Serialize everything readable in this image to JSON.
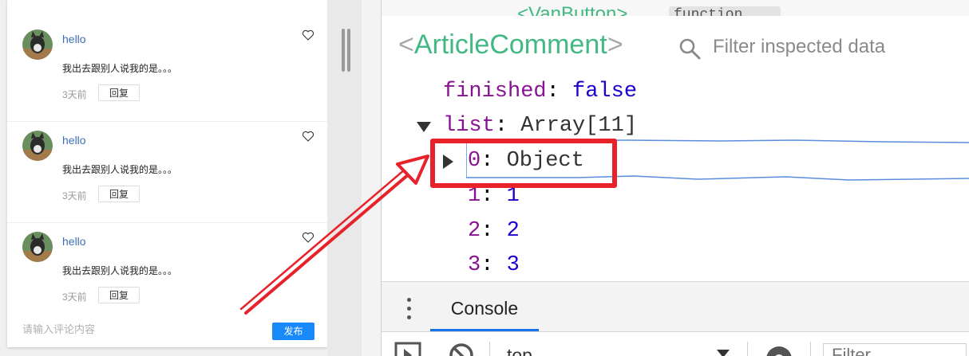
{
  "app": {
    "comments": [
      {
        "user": "hello",
        "text": "我出去跟别人说我的是。。。",
        "time": "3天前",
        "reply_label": "回复"
      },
      {
        "user": "hello",
        "text": "我出去跟别人说我的是。。。",
        "time": "3天前",
        "reply_label": "回复"
      },
      {
        "user": "hello",
        "text": "我出去跟别人说我的是。。。",
        "time": "3天前",
        "reply_label": "回复"
      }
    ],
    "input_placeholder": "请输入评论内容",
    "publish_label": "发布"
  },
  "devtools": {
    "top_peek": {
      "component": "<VanButton>",
      "tag": "function"
    },
    "component": {
      "open": "<",
      "name": "ArticleComment",
      "close": ">"
    },
    "filter_placeholder": "Filter inspected data",
    "state": {
      "finished": {
        "key": "finished",
        "sep": ": ",
        "value": "false"
      },
      "list": {
        "key": "list",
        "sep": ": ",
        "value": "Array[11]"
      },
      "items": [
        {
          "key": "0",
          "sep": ": ",
          "value": "Object"
        },
        {
          "key": "1",
          "sep": ": ",
          "value": "1"
        },
        {
          "key": "2",
          "sep": ": ",
          "value": "2"
        },
        {
          "key": "3",
          "sep": ": ",
          "value": "3"
        }
      ]
    },
    "drawer": {
      "console_tab": "Console"
    },
    "toolbar": {
      "context": "top",
      "filter_placeholder": "Filter"
    }
  },
  "colors": {
    "vue_green": "#42b883",
    "highlight_red": "#e8222a",
    "link_blue": "#3f6fb5",
    "primary_blue": "#1989fa"
  }
}
